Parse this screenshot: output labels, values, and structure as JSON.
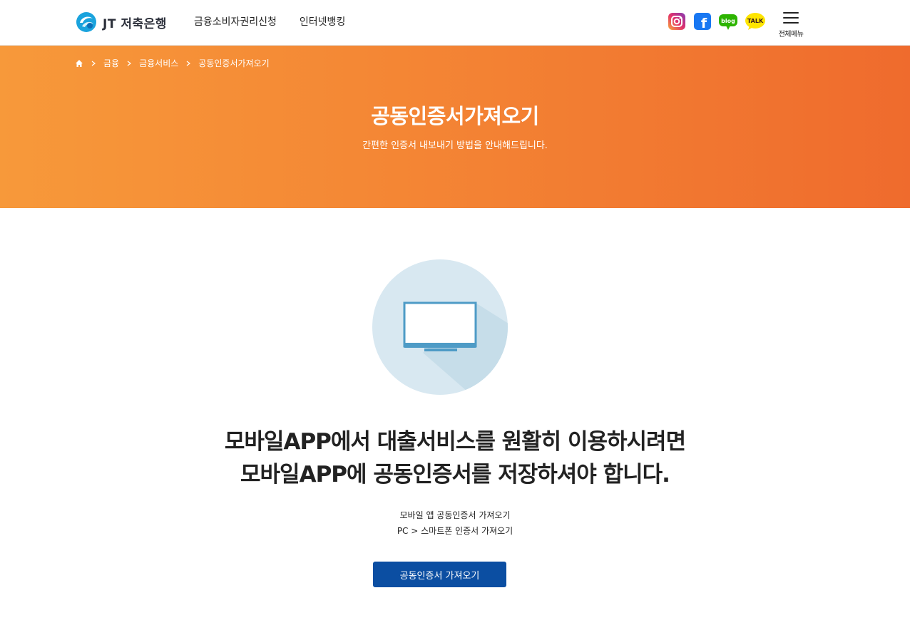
{
  "header": {
    "logo_text": "JT 저축은행",
    "nav": [
      {
        "label": "금융소비자권리신청"
      },
      {
        "label": "인터넷뱅킹"
      }
    ],
    "social": [
      {
        "name": "instagram-icon"
      },
      {
        "name": "facebook-icon",
        "glyph": "f"
      },
      {
        "name": "blog-icon",
        "glyph": "blog"
      },
      {
        "name": "kakaotalk-icon",
        "glyph": "TALK"
      }
    ],
    "menu_label": "전체메뉴"
  },
  "colors": {
    "banner_start": "#f7993a",
    "banner_end": "#ef6b2d",
    "cta": "#0b4ea2",
    "illus_circle": "#d8e8f1",
    "monitor": "#4e9bc6"
  },
  "breadcrumb": {
    "home_icon": "home-icon",
    "items": [
      "금융",
      "금융서비스",
      "공동인증서가져오기"
    ]
  },
  "banner": {
    "title": "공동인증서가져오기",
    "subtitle": "간편한 인증서 내보내기 방법을 안내해드립니다."
  },
  "main": {
    "illustration_icon": "monitor-icon",
    "headline_lines": [
      "모바일APP에서 대출서비스를 원활히 이용하시려면",
      "모바일APP에 공동인증서를 저장하셔야 합니다."
    ],
    "links": [
      "모바일 앱 공동인증서 가져오기",
      "PC > 스마트폰 인증서 가져오기"
    ],
    "cta_label": "공동인증서 가져오기"
  }
}
